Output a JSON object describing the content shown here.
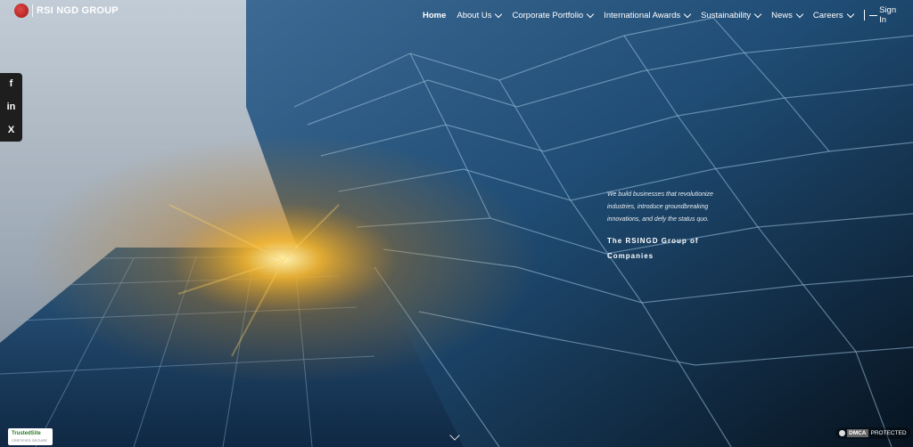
{
  "brand": {
    "name": "RSI NGD GROUP"
  },
  "nav": {
    "items": [
      {
        "label": "Home",
        "has_dropdown": false,
        "active": true
      },
      {
        "label": "About Us",
        "has_dropdown": true,
        "active": false
      },
      {
        "label": "Corporate Portfolio",
        "has_dropdown": true,
        "active": false
      },
      {
        "label": "International Awards",
        "has_dropdown": true,
        "active": false
      },
      {
        "label": "Sustainability",
        "has_dropdown": true,
        "active": false
      },
      {
        "label": "News",
        "has_dropdown": true,
        "active": false
      },
      {
        "label": "Careers",
        "has_dropdown": true,
        "active": false
      }
    ],
    "sign_in": "Sign In",
    "search_icon": "search-icon"
  },
  "social": {
    "facebook": "f",
    "linkedin": "in",
    "x": "X"
  },
  "hero": {
    "tagline": "We build businesses that revolutionize industries, introduce groundbreaking innovations, and defy the status quo.",
    "company_line1": "The RSINGD Group of",
    "company_line2": "Companies"
  },
  "badges": {
    "trusted_name": "TrustedSite",
    "trusted_sub": "CERTIFIED SECURE",
    "dmca_label": "DMCA",
    "dmca_status": "PROTECTED"
  },
  "colors": {
    "sky": "#b9c4cf",
    "glass": "#1b3a5c",
    "sun": "#f2a41c"
  }
}
